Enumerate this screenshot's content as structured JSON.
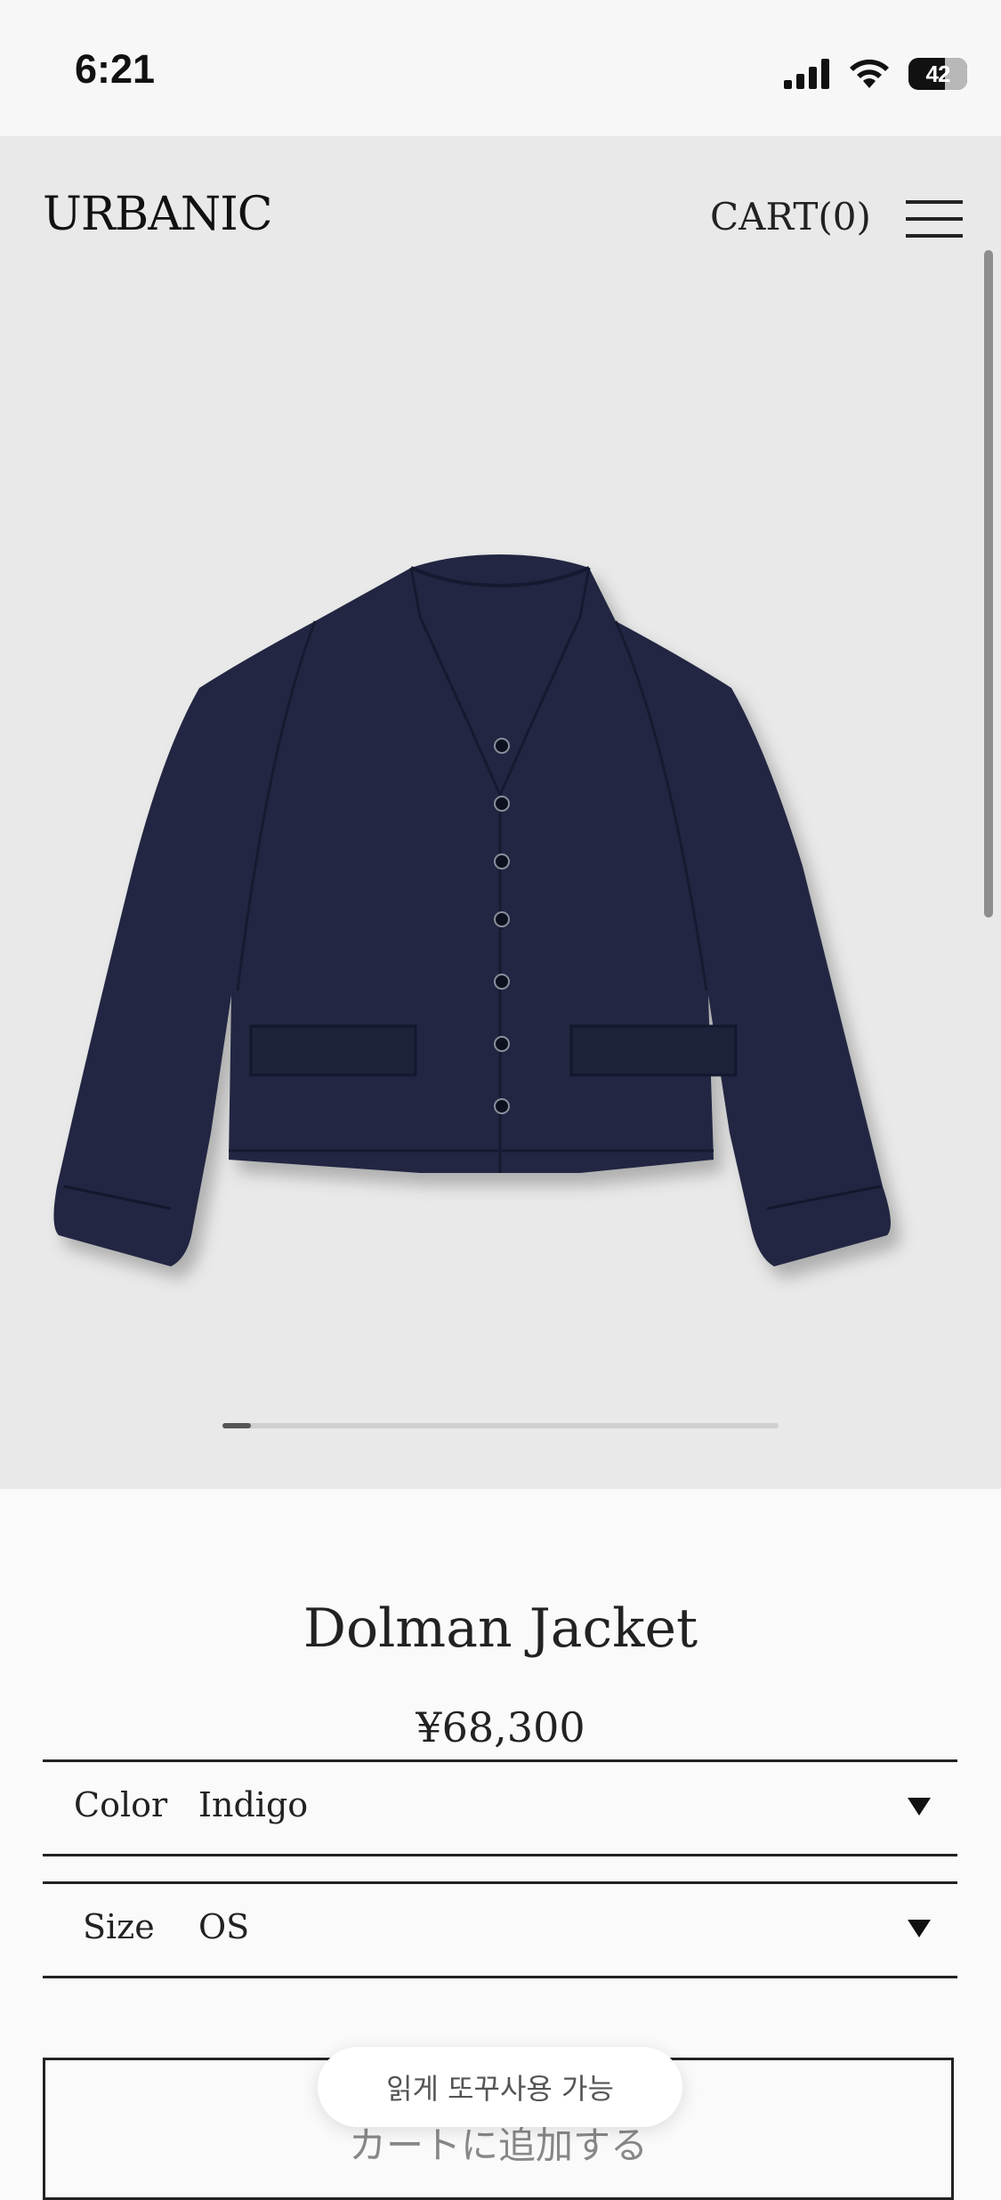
{
  "status_bar": {
    "time": "6:21",
    "battery": "42"
  },
  "header": {
    "logo": "URBANIC",
    "cart": "CART(0)"
  },
  "colors": {
    "hero_bg": "#e9e9e9",
    "denim": "#202742",
    "text": "#1a1a1a"
  },
  "product": {
    "title": "Dolman Jacket",
    "price": "¥68,300"
  },
  "options": {
    "color": {
      "label": "Color",
      "value": "Indigo"
    },
    "size": {
      "label": "Size",
      "value": "OS"
    }
  },
  "add_to_cart": {
    "label": "カートに追加する"
  },
  "toast": {
    "text": "읽게 또꾸사용 가능"
  }
}
